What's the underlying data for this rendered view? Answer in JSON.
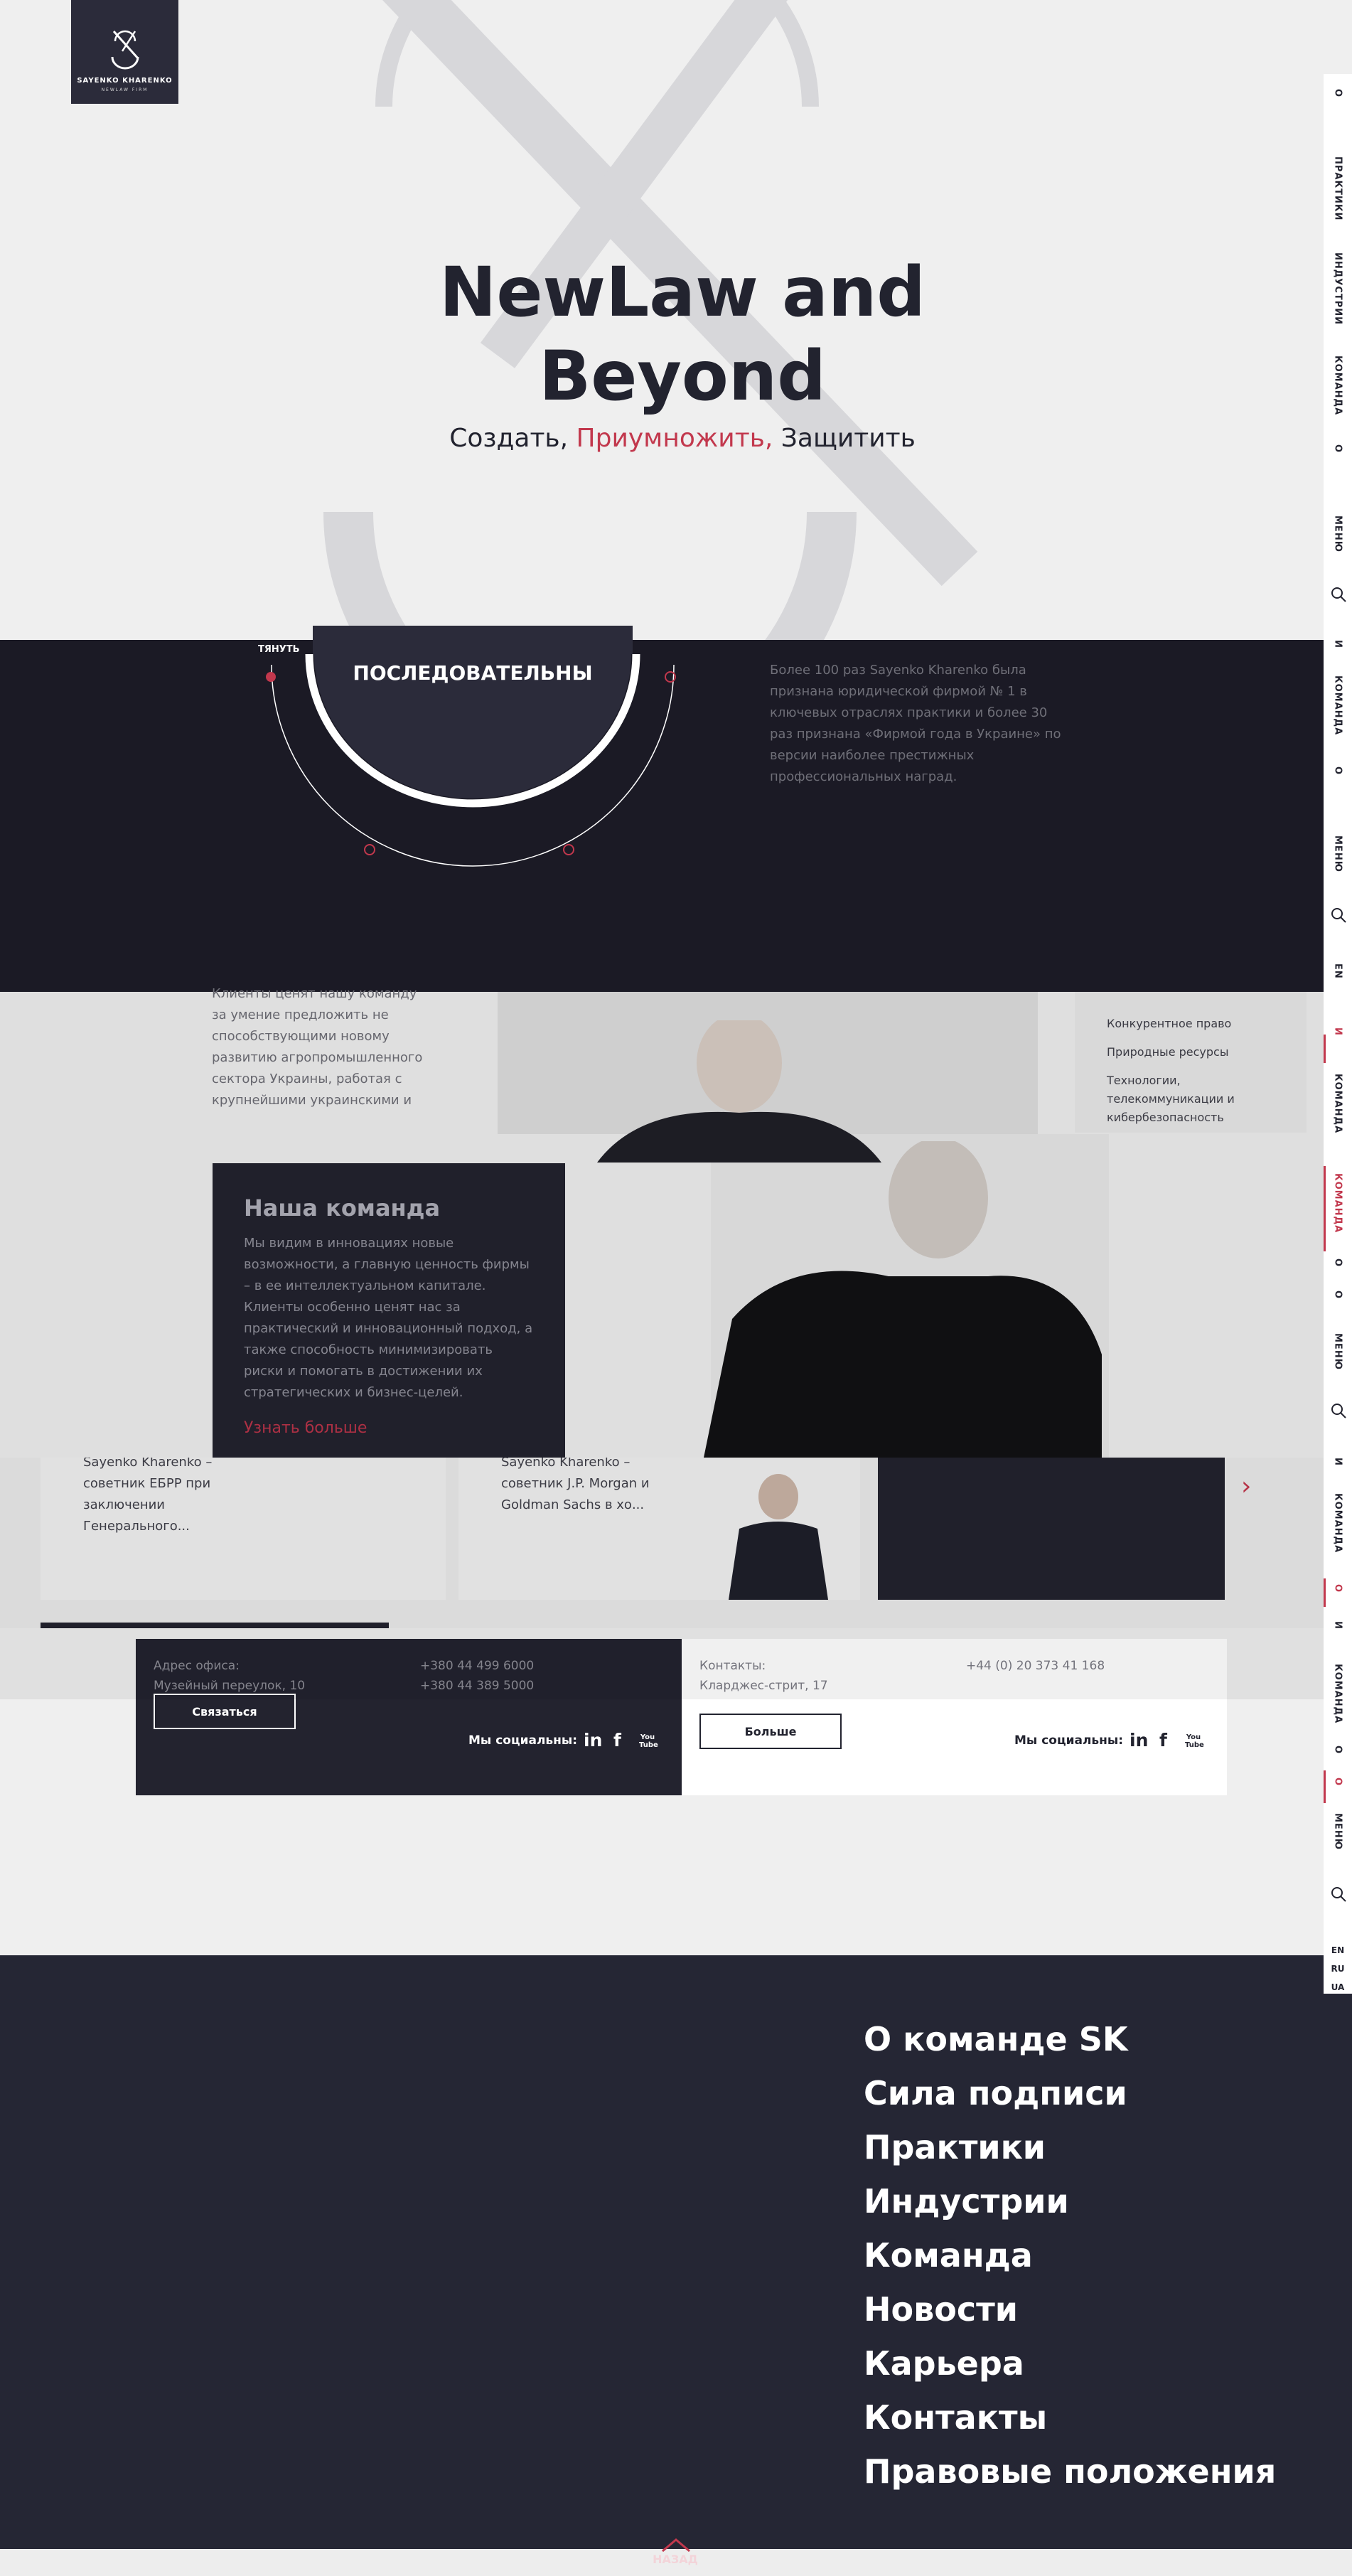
{
  "logo": {
    "brand": "SAYENKO KHARENKO",
    "sub": "NEWLAW FIRM"
  },
  "hero": {
    "title_line1": "NewLaw and",
    "title_line2": "Beyond",
    "sub_a": "Создать,",
    "sub_b": "Приумножить,",
    "sub_c": "Защитить",
    "accent": "#c2384d"
  },
  "band": {
    "pull": "ТЯНУТЬ",
    "ring_label": "ПОСЛЕДОВАТЕЛЬНЫ",
    "text": "Более 100 раз Sayenko Kharenko была признана юридической фирмой № 1 в ключевых отраслях практики и более 30 раз признана «Фирмой года в Украине» по версии наиболее престижных профессиональных наград."
  },
  "team": {
    "left_text": "Клиенты ценят нашу команду за умение предложить не способствующими новому развитию агропромышленного сектора Украины, работая с крупнейшими украинскими и",
    "menu": [
      "Конкурентное право",
      "Природные ресурсы",
      "Технологии, телекоммуникации и кибербезопасность"
    ],
    "card_title": "Наша команда",
    "card_text": "Мы видим в инновациях новые возможности, а главную ценность фирмы – в ее интеллектуальном капитале. Клиенты особенно ценят нас за практический и инновационный подход, а также способность минимизировать риски и помогать в достижении их стратегических и бизнес-целей.",
    "card_link": "Узнать больше"
  },
  "news": {
    "item1": "Sayenko Kharenko – советник ЕБРР при заключении Генерального...",
    "item2": "Sayenko Kharenko – советник J.P. Morgan и Goldman Sachs в хо..."
  },
  "office_kyiv": {
    "label": "Адрес офиса:",
    "address": "Музейный переулок, 10",
    "phone1": "+380 44 499 6000",
    "phone2": "+380 44 389 5000",
    "button": "Связаться",
    "social_label": "Мы социальны:"
  },
  "office_london": {
    "label": "Контакты:",
    "address": "Кларджес-стрит, 17",
    "phone": "+44 (0) 20 373 41 168",
    "button": "Больше",
    "social_label": "Мы социальны:"
  },
  "social": {
    "linkedin": "in",
    "facebook": "f",
    "youtube": "You Tube"
  },
  "footer_nav": [
    "О команде SK",
    "Сила подписи",
    "Практики",
    "Индустрии",
    "Команда",
    "Новости",
    "Карьера",
    "Контакты",
    "Правовые положения"
  ],
  "back": "НАЗАД",
  "vnav": {
    "o": "О",
    "practices": "ПРАКТИКИ",
    "industries": "ИНДУСТРИИ",
    "team": "КОМАНДА",
    "menu": "МЕНЮ",
    "i": "И",
    "en": "EN",
    "en_ru_ua": "EN RU UA"
  }
}
